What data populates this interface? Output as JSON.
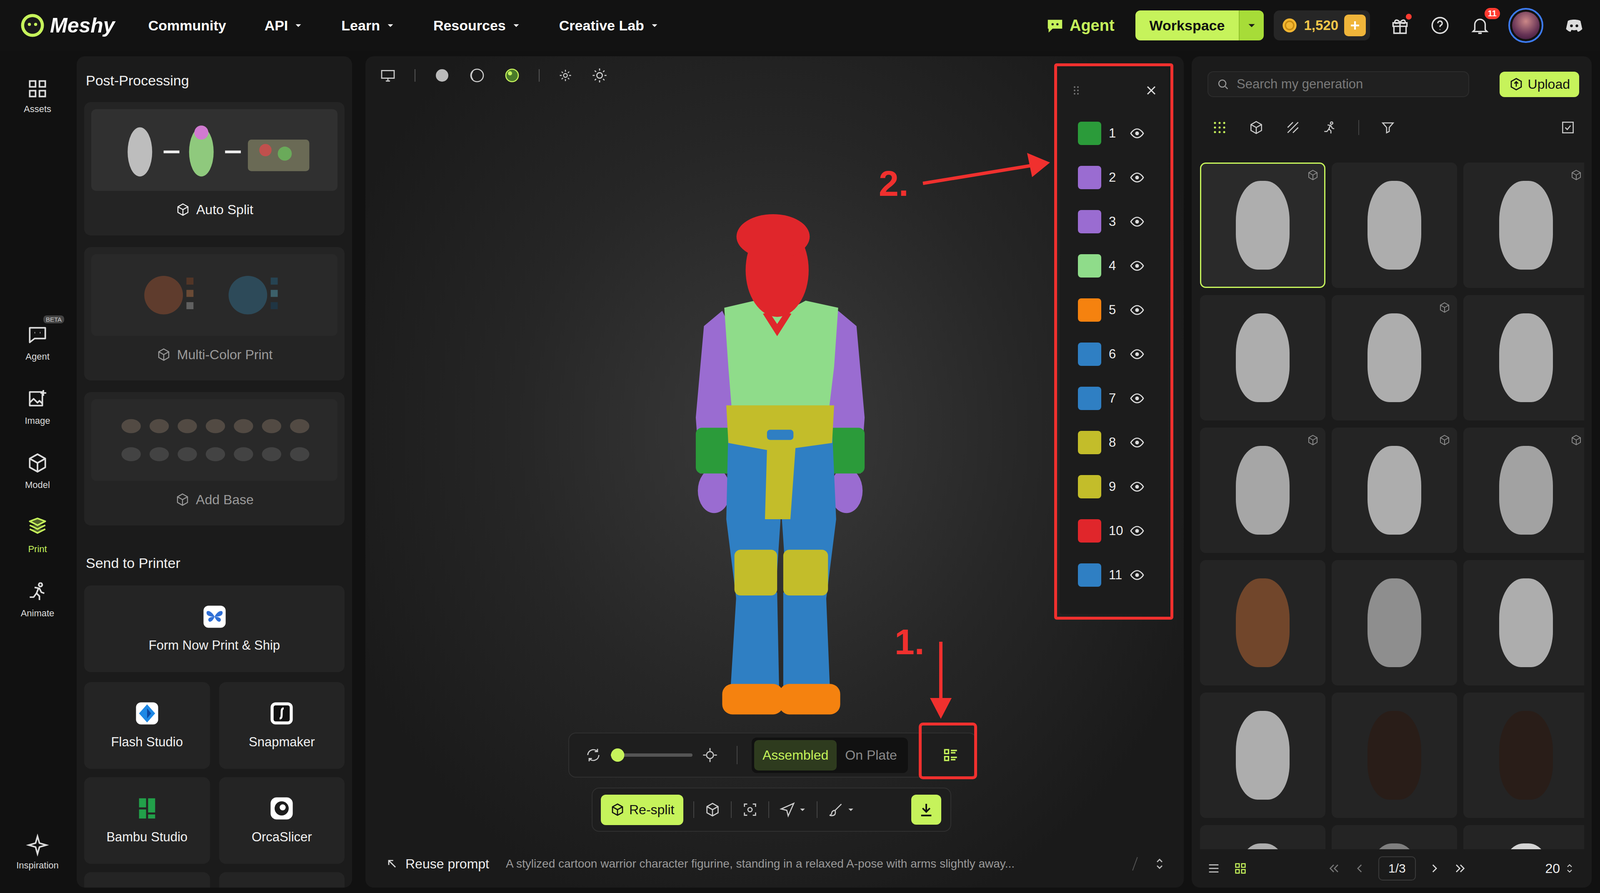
{
  "nav": {
    "logo": "Meshy",
    "items": [
      {
        "label": "Community",
        "dropdown": false
      },
      {
        "label": "API",
        "dropdown": true
      },
      {
        "label": "Learn",
        "dropdown": true
      },
      {
        "label": "Resources",
        "dropdown": true
      },
      {
        "label": "Creative Lab",
        "dropdown": true
      }
    ],
    "agent": "Agent",
    "workspace": "Workspace",
    "credits": "1,520",
    "gift_dot": true,
    "notifications": "11"
  },
  "rail": {
    "top": {
      "label": "Assets",
      "selected": false
    },
    "items": [
      {
        "label": "Agent",
        "badge": "BETA",
        "selected": false
      },
      {
        "label": "Image",
        "badge": "",
        "selected": false
      },
      {
        "label": "Model",
        "badge": "",
        "selected": false
      },
      {
        "label": "Print",
        "badge": "",
        "selected": true
      },
      {
        "label": "Animate",
        "badge": "",
        "selected": false
      }
    ],
    "bottom": {
      "label": "Inspiration",
      "selected": false
    }
  },
  "post_processing": {
    "title": "Post-Processing",
    "tools": [
      {
        "label": "Auto Split",
        "enabled": true
      },
      {
        "label": "Multi-Color Print",
        "enabled": false
      },
      {
        "label": "Add Base",
        "enabled": false
      }
    ]
  },
  "send_to_printer": {
    "title": "Send to Printer",
    "featured": "Form Now Print & Ship",
    "apps": [
      "Flash Studio",
      "Snapmaker",
      "Bambu Studio",
      "OrcaSlicer"
    ]
  },
  "viewport": {
    "parts": [
      {
        "label": "1",
        "color": "#2b9b3a",
        "visible": true
      },
      {
        "label": "2",
        "color": "#9a6cd1",
        "visible": true
      },
      {
        "label": "3",
        "color": "#9a6cd1",
        "visible": true
      },
      {
        "label": "4",
        "color": "#8fdc8a",
        "visible": true
      },
      {
        "label": "5",
        "color": "#f5820f",
        "visible": true
      },
      {
        "label": "6",
        "color": "#2f7fc3",
        "visible": true
      },
      {
        "label": "7",
        "color": "#2f7fc3",
        "visible": true
      },
      {
        "label": "8",
        "color": "#c3bd2a",
        "visible": true
      },
      {
        "label": "9",
        "color": "#c3bd2a",
        "visible": true
      },
      {
        "label": "10",
        "color": "#e0262b",
        "visible": true
      },
      {
        "label": "11",
        "color": "#2f7fc3",
        "visible": true
      }
    ],
    "explode_level": 0.05,
    "view_toggle": [
      {
        "label": "Assembled",
        "selected": true
      },
      {
        "label": "On Plate",
        "selected": false
      }
    ],
    "resplit": "Re-split",
    "reuse_prompt": "Reuse prompt",
    "prompt": "A stylized cartoon warrior character figurine, standing in a relaxed A-pose with arms slightly away..."
  },
  "annotations": [
    {
      "label": "1."
    },
    {
      "label": "2."
    }
  ],
  "library": {
    "search_placeholder": "Search my generation",
    "upload": "Upload",
    "tiles": [
      {
        "selected": true,
        "mark": true,
        "color": "#bdbdbd"
      },
      {
        "selected": false,
        "mark": false,
        "color": "#bdbdbd"
      },
      {
        "selected": false,
        "mark": true,
        "color": "#bdbdbd"
      },
      {
        "selected": false,
        "mark": false,
        "color": "#bdbdbd"
      },
      {
        "selected": false,
        "mark": true,
        "color": "#bdbdbd"
      },
      {
        "selected": false,
        "mark": false,
        "color": "#bdbdbd"
      },
      {
        "selected": false,
        "mark": true,
        "color": "#b5b5b5"
      },
      {
        "selected": false,
        "mark": true,
        "color": "#bdbdbd"
      },
      {
        "selected": false,
        "mark": true,
        "color": "#b0b0b0"
      },
      {
        "selected": false,
        "mark": false,
        "color": "#7a4a2c"
      },
      {
        "selected": false,
        "mark": false,
        "color": "#9a9a9a"
      },
      {
        "selected": false,
        "mark": false,
        "color": "#bdbdbd"
      },
      {
        "selected": false,
        "mark": false,
        "color": "#bdbdbd"
      },
      {
        "selected": false,
        "mark": false,
        "color": "#2a1d17"
      },
      {
        "selected": false,
        "mark": false,
        "color": "#2a1d17"
      },
      {
        "selected": false,
        "mark": false,
        "color": "#bdbdbd"
      },
      {
        "selected": false,
        "mark": false,
        "color": "#8a8a8a"
      },
      {
        "selected": false,
        "mark": false,
        "color": "#e8e8e8"
      }
    ],
    "page": "1/3",
    "page_size": "20"
  }
}
